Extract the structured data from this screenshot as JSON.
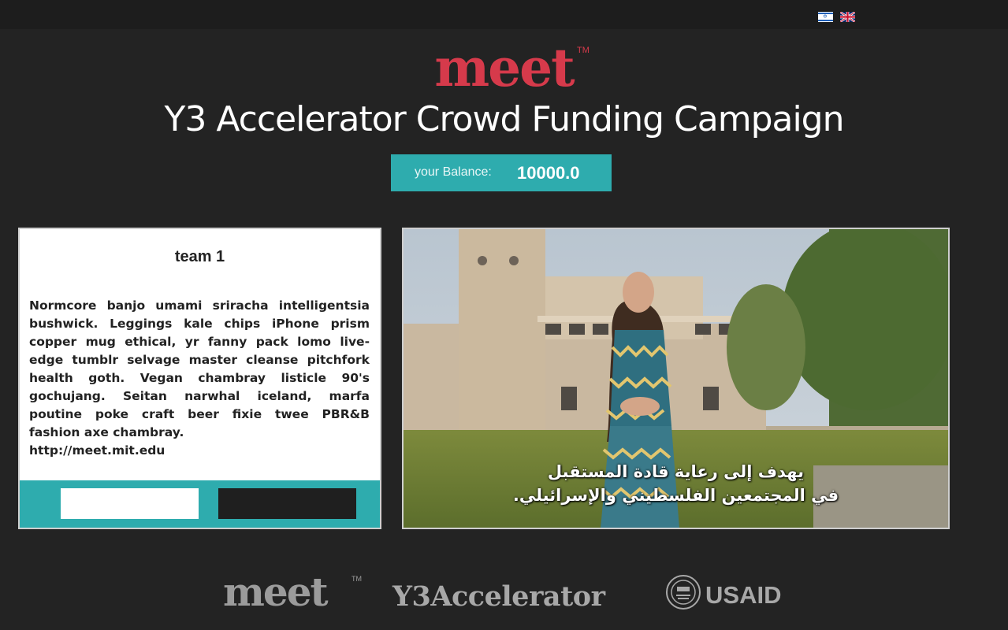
{
  "header": {
    "languages": [
      {
        "name": "Hebrew",
        "icon": "israel-flag-icon"
      },
      {
        "name": "English",
        "icon": "uk-flag-icon"
      }
    ]
  },
  "brand": {
    "logo_text": "meet",
    "trademark": "TM",
    "accent_color": "#d63a4b"
  },
  "page": {
    "title": "Y3 Accelerator Crowd Funding Campaign"
  },
  "balance": {
    "label": "your Balance:",
    "value": "10000.0",
    "color": "#2eacae"
  },
  "team_card": {
    "name": "team 1",
    "description": "Normcore banjo umami sriracha intelligentsia bushwick. Leggings kale chips iPhone prism copper mug ethical, yr fanny pack lomo live-edge tumblr selvage master cleanse pitchfork health goth. Vegan chambray listicle 90's gochujang. Seitan narwhal iceland, marfa poutine poke craft beer fixie twee PBR&B fashion axe chambray.",
    "link": "http://meet.mit.edu"
  },
  "video": {
    "subtitle_line1": "يهدف إلى رعاية قادة المستقبل",
    "subtitle_line2": "في المجتمعين الفلسطيني والإسرائيلي."
  },
  "partners": {
    "meet_logo": "meet",
    "meet_tm": "TM",
    "y3_logo": "Y3Accelerator",
    "usaid_logo": "USAID",
    "usaid_seal_icon": "usaid-seal-icon"
  }
}
